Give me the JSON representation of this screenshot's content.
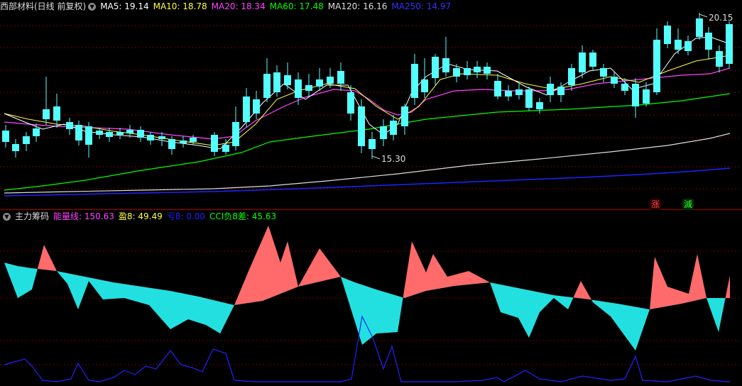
{
  "colors": {
    "up": "#ff5555",
    "down": "#54ffff",
    "grid": "#7a0000",
    "border": "#b00000",
    "ma5": "#ffffff",
    "ma10": "#ffff44",
    "ma20": "#ff44ff",
    "ma60": "#00ff00",
    "ma120": "#dddddd",
    "ma250": "#2222ff",
    "energy_pos": "#ff6a6a",
    "energy_neg": "#22e0e0",
    "blue_line": "#2222ff"
  },
  "price_panel": {
    "title": "西部材料(日线 前复权)",
    "indicators": [
      {
        "label": "MA5: 19.14",
        "color": "#ffffff"
      },
      {
        "label": "MA10: 18.78",
        "color": "#ffff44"
      },
      {
        "label": "MA20: 18.34",
        "color": "#ff44ff"
      },
      {
        "label": "MA60: 17.48",
        "color": "#00ff00"
      },
      {
        "label": "MA120: 16.16",
        "color": "#dddddd"
      },
      {
        "label": "MA250: 14.97",
        "color": "#3333ff"
      }
    ],
    "high_label": "20.15",
    "low_label": "15.30",
    "tag_up": "涨",
    "tag_down": "減"
  },
  "indicator_panel": {
    "title": "主力筹码",
    "indicators": [
      {
        "label": "能量线: 150.63",
        "color": "#ff44ff"
      },
      {
        "label": "盈8: 49.49",
        "color": "#ffff44"
      },
      {
        "label": "亏8: 0.00",
        "color": "#2222ff"
      },
      {
        "label": "CCI负8差: 45.63",
        "color": "#00ff00"
      }
    ]
  }
}
